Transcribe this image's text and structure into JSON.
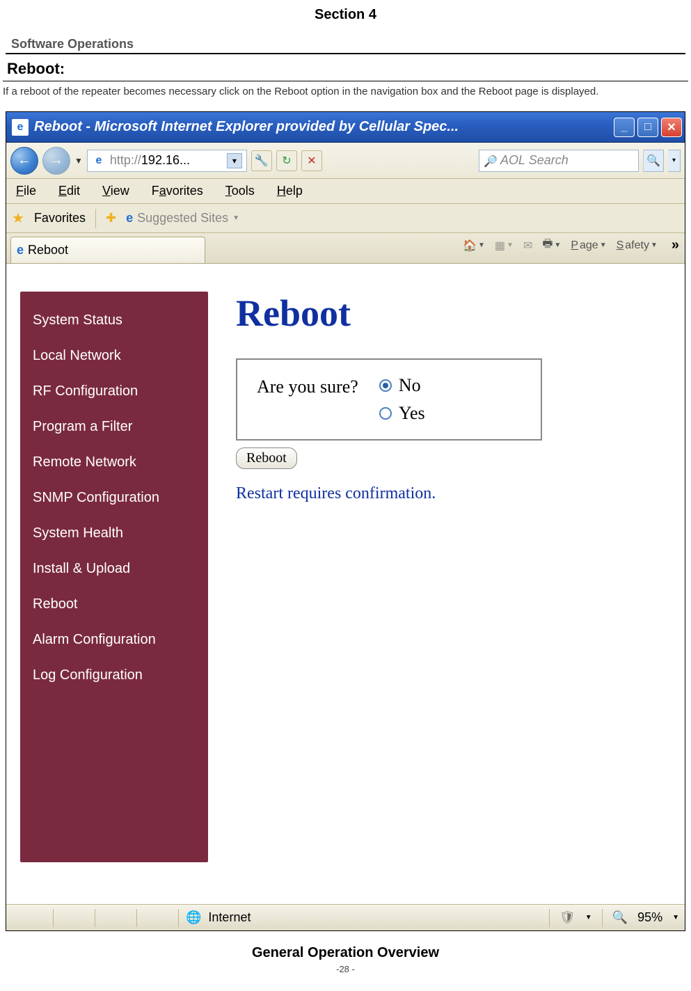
{
  "doc": {
    "section_title": "Section 4",
    "subsection": "Software Operations",
    "heading": "Reboot:",
    "intro": "If a reboot of the repeater becomes necessary click on the Reboot option in the navigation box and the Reboot page is displayed.",
    "footer_title": "General Operation Overview",
    "page_number": "-28 -"
  },
  "browser": {
    "title": "Reboot - Microsoft Internet Explorer provided by Cellular Spec...",
    "address_prefix": "http://",
    "address_bold": "192.16...",
    "search_placeholder": "AOL Search",
    "menus": {
      "file": "File",
      "edit": "Edit",
      "view": "View",
      "favorites": "Favorites",
      "tools": "Tools",
      "help": "Help"
    },
    "favbar_label": "Favorites",
    "suggested_sites": "Suggested Sites",
    "tab_label": "Reboot",
    "page_menu": "Page",
    "safety_menu": "Safety",
    "status_zone": "Internet",
    "zoom": "95%"
  },
  "app": {
    "sidenav": {
      "items": [
        "System Status",
        "Local Network",
        "RF Configuration",
        "Program a Filter",
        "Remote Network",
        "SNMP Configuration",
        "System Health",
        "Install & Upload",
        "Reboot",
        "Alarm Configuration",
        "Log Configuration"
      ]
    },
    "main": {
      "title": "Reboot",
      "question": "Are you sure?",
      "option_no": "No",
      "option_yes": "Yes",
      "button_label": "Reboot",
      "note": "Restart requires confirmation."
    }
  }
}
